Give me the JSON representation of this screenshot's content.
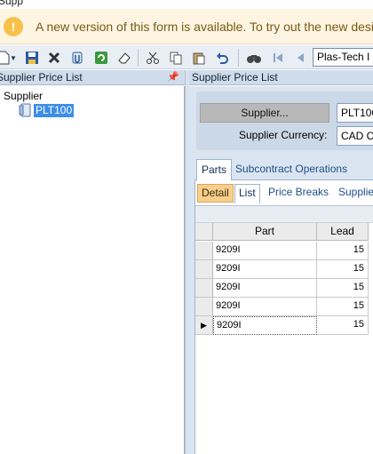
{
  "window": {
    "title": "Supp"
  },
  "banner": {
    "message": "A new version of this form is available. To try out the new design a"
  },
  "toolbar": {
    "icons": [
      "new-icon",
      "dropdown-arrow-icon",
      "save-icon",
      "delete-icon",
      "attach-icon",
      "refresh-icon",
      "clear-icon",
      "cut-icon",
      "copy-icon",
      "paste-icon",
      "undo-icon",
      "search-icon",
      "first-record-icon",
      "previous-record-icon"
    ],
    "record_value": "Plas-Tech I"
  },
  "left_pane": {
    "header": "Supplier Price List",
    "tree": {
      "root": "Supplier",
      "node": "PLT100"
    }
  },
  "right_pane": {
    "header": "Supplier Price List",
    "supplier_button": "Supplier...",
    "supplier_value": "PLT100",
    "currency_label": "Supplier Currency:",
    "currency_value": "CAD Co"
  },
  "tabs": [
    "Parts",
    "Subcontract Operations"
  ],
  "subtabs": [
    "Detail",
    "List",
    "Price Breaks",
    "Supplie"
  ],
  "grid": {
    "columns": [
      "Part",
      "Lead"
    ],
    "rows": [
      {
        "part": "9209I",
        "lead": "15"
      },
      {
        "part": "9209I",
        "lead": "15"
      },
      {
        "part": "9209I",
        "lead": "15"
      },
      {
        "part": "9209I",
        "lead": "15"
      },
      {
        "part": "9209I",
        "lead": "15"
      }
    ]
  }
}
